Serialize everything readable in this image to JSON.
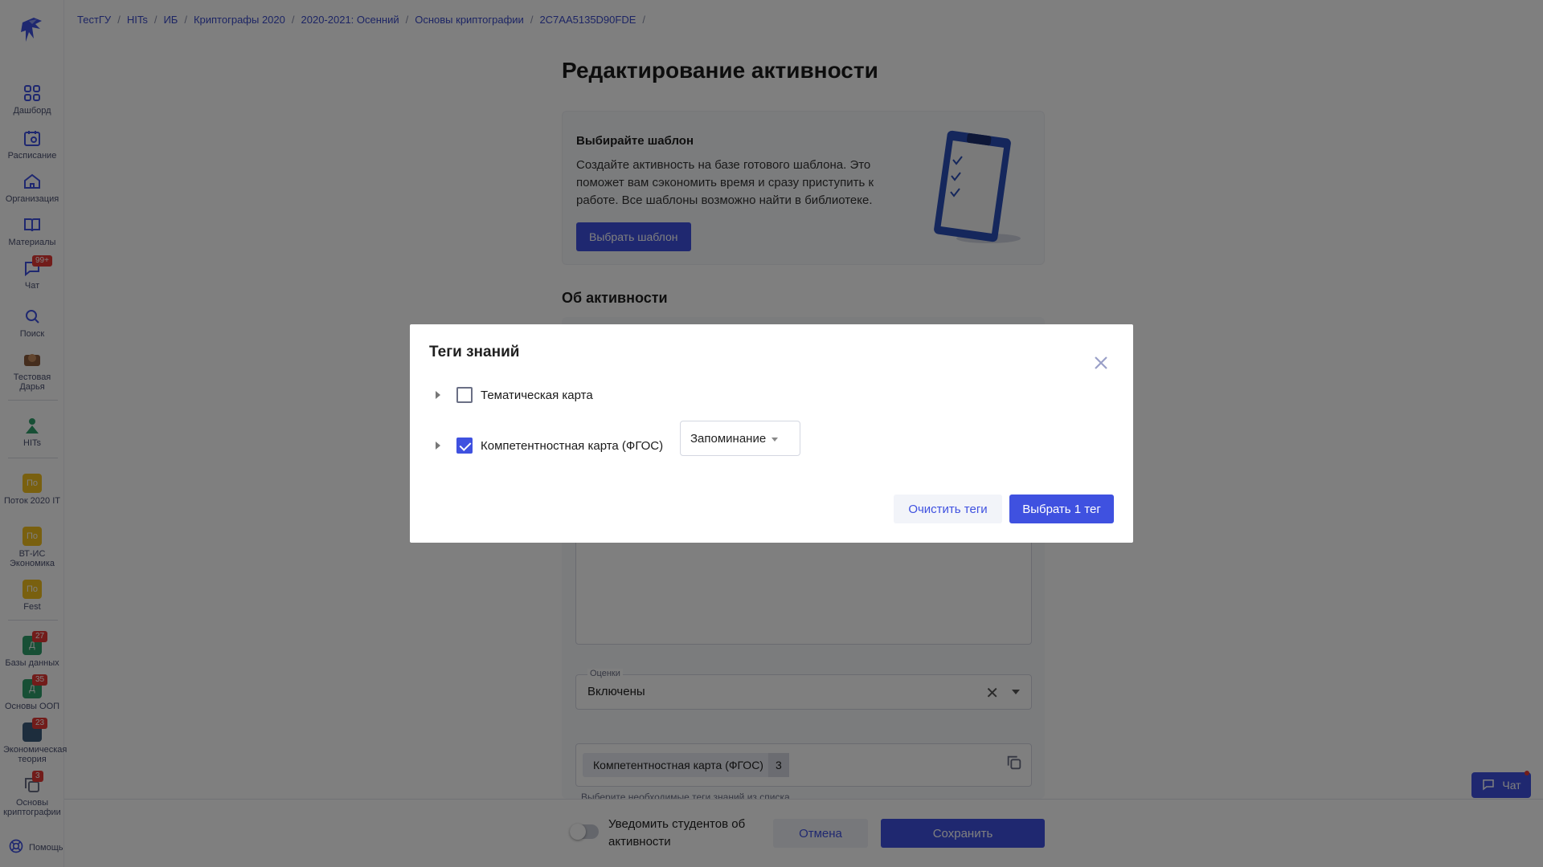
{
  "breadcrumb": [
    "ТестГУ",
    "HITs",
    "ИБ",
    "Криптографы 2020",
    "2020-2021: Осенний",
    "Основы криптографии",
    "2C7AA5135D90FDE"
  ],
  "page_title": "Редактирование активности",
  "template_card": {
    "title": "Выбирайте шаблон",
    "text": "Создайте активность на базе готового шаблона. Это поможет вам сэкономить время и сразу приступить к работе. Все шаблоны возможно найти в библиотеке.",
    "button": "Выбрать шаблон"
  },
  "about_title": "Об активности",
  "grades_field": {
    "label": "Оценки",
    "value": "Включены"
  },
  "tags_field": {
    "chip_label": "Компетентностная карта (ФГОС)",
    "chip_count": "3",
    "hint": "Выберите необходимые теги знаний из списка"
  },
  "footer": {
    "notify_label": "Уведомить студентов об активности",
    "cancel": "Отмена",
    "save": "Сохранить"
  },
  "chat_widget": "Чат",
  "sidebar": {
    "items": [
      {
        "label": "Дашборд",
        "icon": "grid-icon"
      },
      {
        "label": "Расписание",
        "icon": "calendar-icon"
      },
      {
        "label": "Организация",
        "icon": "home-icon"
      },
      {
        "label": "Материалы",
        "icon": "book-icon"
      },
      {
        "label": "Чат",
        "icon": "chat-icon",
        "badge": "99+"
      },
      {
        "label": "Поиск",
        "icon": "search-icon"
      },
      {
        "label": "Тестовая Дарья",
        "icon": "avatar"
      },
      {
        "label": "HITs",
        "icon": "org-avatar"
      }
    ],
    "streams": [
      {
        "label": "Поток 2020 IT",
        "initials": "По"
      },
      {
        "label": "ВТ-ИС Экономика",
        "initials": "По"
      },
      {
        "label": "Fest",
        "initials": "По"
      }
    ],
    "courses": [
      {
        "label": "Базы данных",
        "initials": "Д",
        "badge": "27"
      },
      {
        "label": "Основы ООП",
        "initials": "Д",
        "badge": "35"
      },
      {
        "label": "Экономическая теория",
        "initials": "",
        "badge": "23"
      },
      {
        "label": "Основы криптографии",
        "initials": "",
        "badge": "3"
      }
    ],
    "help": "Помощь"
  },
  "modal": {
    "title": "Теги знаний",
    "tags": [
      {
        "label": "Тематическая карта",
        "checked": false
      },
      {
        "label": "Компетентностная карта (ФГОС)",
        "checked": true
      }
    ],
    "level_select": "Запоминание",
    "clear_button": "Очистить теги",
    "select_button": "Выбрать 1 тег"
  },
  "colors": {
    "accent": "#3f51e0",
    "badge": "#e53935",
    "stream": "#f2c01e",
    "course": "#2e9e6b"
  }
}
